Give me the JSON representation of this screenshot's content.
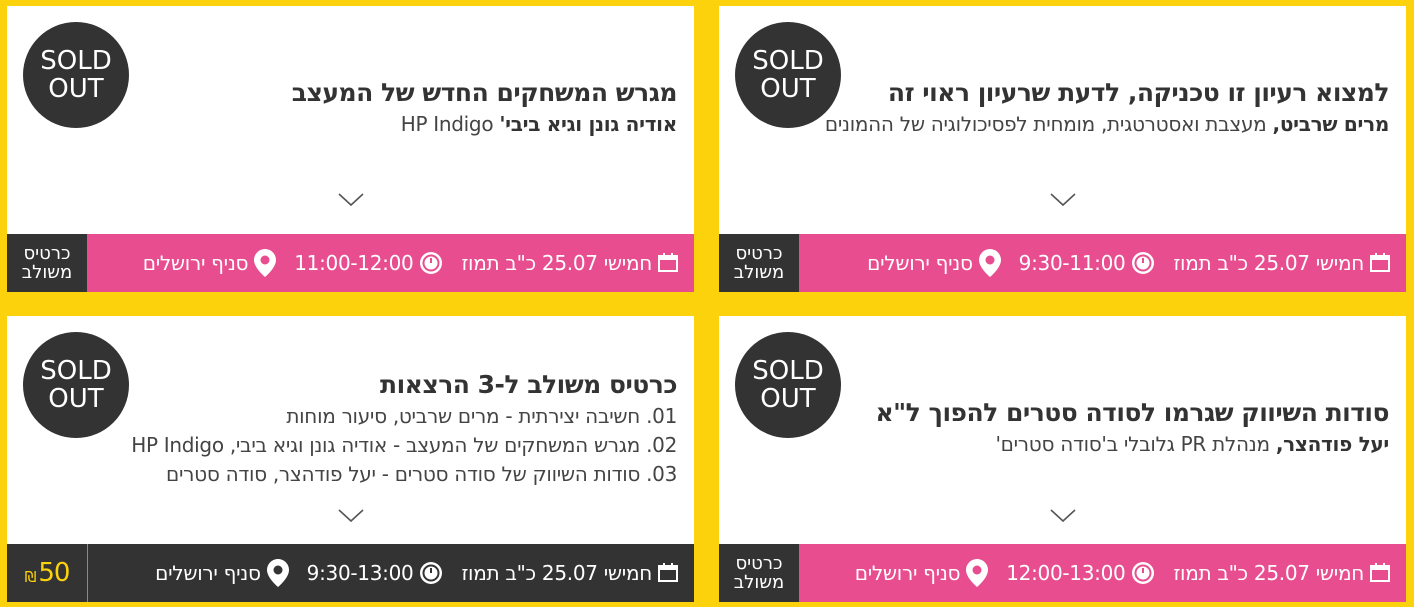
{
  "sold_out": {
    "line1": "SOLD",
    "line2": "OUT"
  },
  "combo_badge": {
    "line1": "כרטיס",
    "line2": "משולב"
  },
  "colors": {
    "background": "#fcd20c",
    "pink_bar": "#e84e8f",
    "dark": "#333333",
    "price": "#fcd20c"
  },
  "cards": [
    {
      "title": "מגרש המשחקים החדש של המעצב",
      "speaker": "אודיה גונן וגיא ביבי'",
      "speaker_rest": " HP Indigo",
      "date": "חמישי 25.07 כ\"ב תמוז",
      "time": "11:00-12:00",
      "location": "סניף ירושלים"
    },
    {
      "title": "למצוא רעיון זו טכניקה, לדעת שרעיון ראוי זה",
      "speaker": "מרים שרביט,",
      "speaker_rest": " מעצבת ואסטרטגית, מומחית לפסיכולוגיה של ההמונים",
      "date": "חמישי 25.07 כ\"ב תמוז",
      "time": "9:30-11:00",
      "location": "סניף ירושלים"
    },
    {
      "title": "כרטיס משולב ל-3 הרצאות",
      "lines": [
        "01. חשיבה יצירתית - מרים שרביט, סיעור מוחות",
        "02. מגרש המשחקים של המעצב - אודיה גונן וגיא ביבי, HP Indigo",
        "03. סודות השיווק של סודה סטרים - יעל פודהצר, סודה סטרים"
      ],
      "date": "חמישי 25.07 כ\"ב תמוז",
      "time": "9:30-13:00",
      "location": "סניף ירושלים",
      "price": "50",
      "currency": "₪"
    },
    {
      "title": "סודות השיווק שגרמו לסודה סטרים להפוך ל\"א",
      "speaker": "יעל פודהצר,",
      "speaker_rest": " מנהלת PR גלובלי ב'סודה סטרים'",
      "date": "חמישי 25.07 כ\"ב תמוז",
      "time": "12:00-13:00",
      "location": "סניף ירושלים"
    }
  ],
  "icons": {
    "calendar": "calendar-icon",
    "clock": "clock-icon",
    "pin": "location-pin-icon",
    "chevron": "chevron-down-icon"
  }
}
